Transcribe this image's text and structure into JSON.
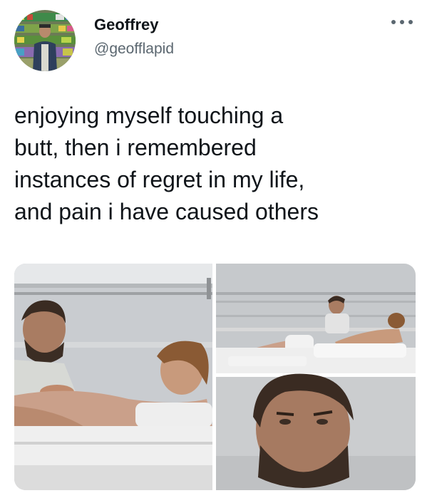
{
  "user": {
    "name": "Geoffrey",
    "handle": "@geofflapid"
  },
  "tweet": {
    "lines": [
      "enjoying myself touching a",
      "butt, then i remembered",
      "instances of regret in my life,",
      "and pain i have caused others"
    ]
  },
  "icons": {
    "more": "more-options-icon"
  },
  "colors": {
    "text": "#0f1419",
    "secondary": "#5b6770"
  }
}
